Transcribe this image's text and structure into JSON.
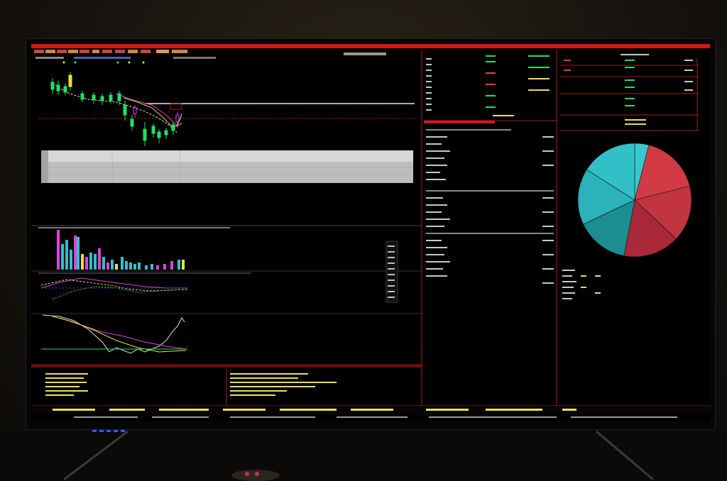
{
  "terminal": {
    "accent_color": "#d01818",
    "panel_line_color": "#b01a1a",
    "text_color": "#c8c8c8",
    "number_color": "#e8e060",
    "up_color": "#20e060",
    "down_color": "#e040e0"
  },
  "scene": {
    "wall_color": "#1e1912",
    "bezel_color": "#050505",
    "led_color": "#2a5cff"
  },
  "chart_data": {
    "type": "pie",
    "values": [
      4,
      17,
      16,
      16,
      15,
      16,
      16
    ],
    "colors": [
      "#39c7cf",
      "#d23b45",
      "#c2343f",
      "#a9283a",
      "#1c8e92",
      "#2bb2bb",
      "#31c0c8"
    ]
  }
}
